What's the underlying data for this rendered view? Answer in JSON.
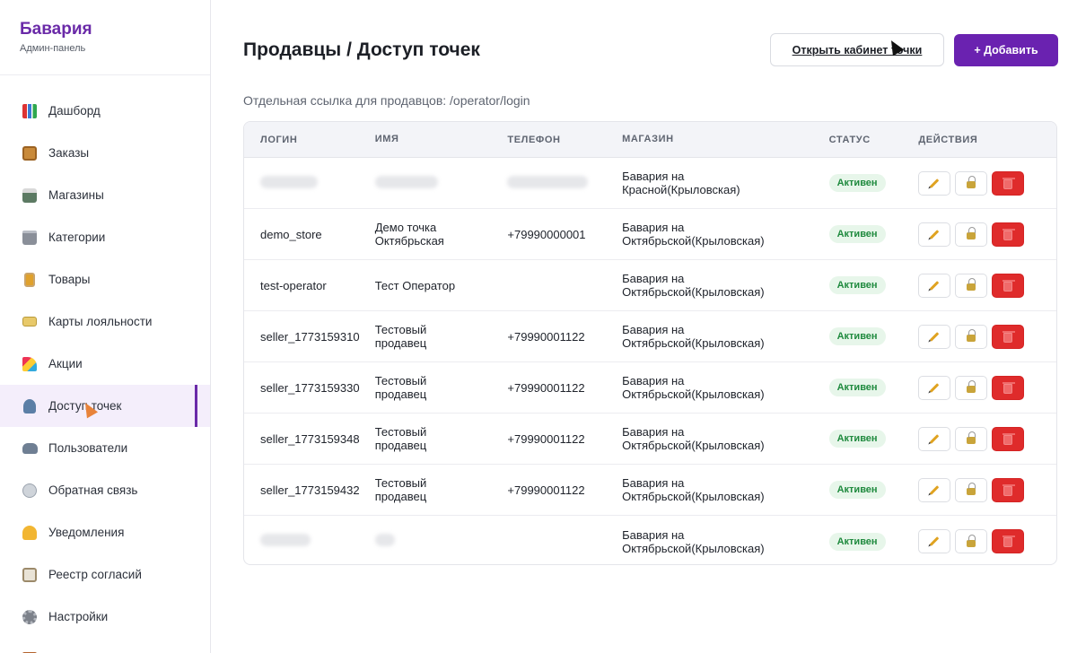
{
  "brand": {
    "title": "Бавария",
    "subtitle": "Админ-панель"
  },
  "sidebar": {
    "items": [
      {
        "label": "Дашборд",
        "icon": "bar-chart-icon"
      },
      {
        "label": "Заказы",
        "icon": "package-icon"
      },
      {
        "label": "Магазины",
        "icon": "shop-icon"
      },
      {
        "label": "Категории",
        "icon": "folder-icon"
      },
      {
        "label": "Товары",
        "icon": "beer-icon"
      },
      {
        "label": "Карты лояльности",
        "icon": "card-icon"
      },
      {
        "label": "Акции",
        "icon": "party-icon"
      },
      {
        "label": "Доступ точек",
        "icon": "user-icon",
        "active": true
      },
      {
        "label": "Пользователи",
        "icon": "users-icon"
      },
      {
        "label": "Обратная связь",
        "icon": "speech-bubble-icon"
      },
      {
        "label": "Уведомления",
        "icon": "bell-icon"
      },
      {
        "label": "Реестр согласий",
        "icon": "register-icon"
      },
      {
        "label": "Настройки",
        "icon": "gear-icon"
      },
      {
        "label": "",
        "icon": "door-icon"
      }
    ]
  },
  "header": {
    "title": "Продавцы / Доступ точек",
    "open_cabinet_label": "Открыть кабинет точки",
    "add_label": "+ Добавить"
  },
  "subtitle": "Отдельная ссылка для продавцов: /operator/login",
  "table": {
    "columns": [
      "Логин",
      "Имя",
      "Телефон",
      "Магазин",
      "Статус",
      "Действия"
    ],
    "rows": [
      {
        "login": "",
        "name": "",
        "phone": "",
        "shop_line1": "Бавария на",
        "shop_line2": "Красной(Крыловская)",
        "status": "Активен",
        "redacted": true
      },
      {
        "login": "demo_store",
        "name_line1": "Демо точка",
        "name_line2": "Октябрьская",
        "phone": "+79990000001",
        "shop_line1": "Бавария на",
        "shop_line2": "Октябрьской(Крыловская)",
        "status": "Активен"
      },
      {
        "login": "test-operator",
        "name_line1": "Тест Оператор",
        "name_line2": "",
        "phone": "",
        "shop_line1": "Бавария на",
        "shop_line2": "Октябрьской(Крыловская)",
        "status": "Активен"
      },
      {
        "login": "seller_1773159310",
        "name_line1": "Тестовый",
        "name_line2": "продавец",
        "phone": "+79990001122",
        "shop_line1": "Бавария на",
        "shop_line2": "Октябрьской(Крыловская)",
        "status": "Активен"
      },
      {
        "login": "seller_1773159330",
        "name_line1": "Тестовый",
        "name_line2": "продавец",
        "phone": "+79990001122",
        "shop_line1": "Бавария на",
        "shop_line2": "Октябрьской(Крыловская)",
        "status": "Активен"
      },
      {
        "login": "seller_1773159348",
        "name_line1": "Тестовый",
        "name_line2": "продавец",
        "phone": "+79990001122",
        "shop_line1": "Бавария на",
        "shop_line2": "Октябрьской(Крыловская)",
        "status": "Активен"
      },
      {
        "login": "seller_1773159432",
        "name_line1": "Тестовый",
        "name_line2": "продавец",
        "phone": "+79990001122",
        "shop_line1": "Бавария на",
        "shop_line2": "Октябрьской(Крыловская)",
        "status": "Активен"
      },
      {
        "login": "",
        "name": "",
        "phone": "",
        "shop_line1": "Бавария на",
        "shop_line2": "Октябрьской(Крыловская)",
        "status": "Активен",
        "redacted": true
      }
    ]
  },
  "colors": {
    "accent": "#6a22b0",
    "status_active": "#1f8a3e",
    "danger": "#df2b2b"
  }
}
